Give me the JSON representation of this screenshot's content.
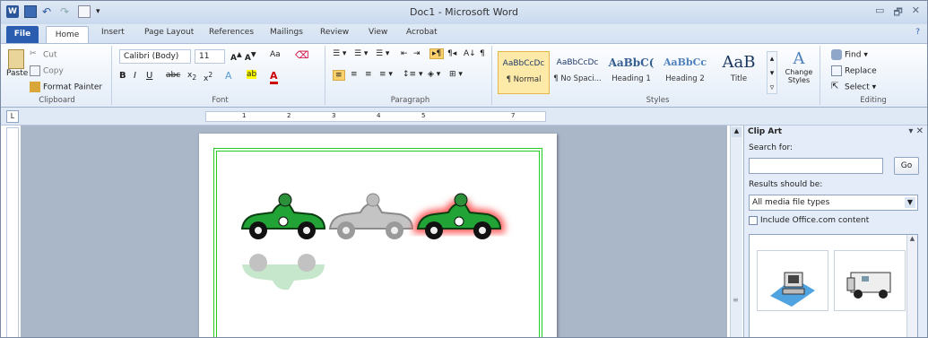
{
  "window": {
    "title": "Doc1 - Microsoft Word",
    "controls": [
      "▭",
      "🗗",
      "✕"
    ]
  },
  "qat": {
    "icon": "word-icon",
    "letter": "W"
  },
  "tabs": [
    "File",
    "Home",
    "Insert",
    "Page Layout",
    "References",
    "Mailings",
    "Review",
    "View",
    "Acrobat"
  ],
  "clipboard": {
    "label": "Clipboard",
    "paste": "Paste",
    "cut": "Cut",
    "copy": "Copy",
    "format_painter": "Format Painter"
  },
  "font": {
    "label": "Font",
    "name": "Calibri (Body)",
    "size": "11",
    "case": "Aa"
  },
  "paragraph": {
    "label": "Paragraph"
  },
  "styles": {
    "label": "Styles",
    "items": [
      {
        "preview": "AaBbCcDc",
        "name": "¶ Normal"
      },
      {
        "preview": "AaBbCcDc",
        "name": "¶ No Spaci..."
      },
      {
        "preview": "AaBbC(",
        "name": "Heading 1"
      },
      {
        "preview": "AaBbCc",
        "name": "Heading 2"
      },
      {
        "preview": "AaB",
        "name": "Title"
      }
    ],
    "change": "Change Styles"
  },
  "editing": {
    "label": "Editing",
    "find": "Find",
    "replace": "Replace",
    "select": "Select"
  },
  "ruler": {
    "tab_stop": "L",
    "marks": [
      "1",
      "2",
      "3",
      "4",
      "5",
      "7"
    ]
  },
  "clipart": {
    "title": "Clip Art",
    "search_label": "Search for:",
    "search_value": "",
    "go": "Go",
    "results_label": "Results should be:",
    "media_type": "All media file types",
    "include_label": "Include Office.com content"
  },
  "colors": {
    "page_border": "#22cc22",
    "car_green": "#21a336",
    "car_grey": "#bdbdbd",
    "glow": "#ff5a5a"
  }
}
